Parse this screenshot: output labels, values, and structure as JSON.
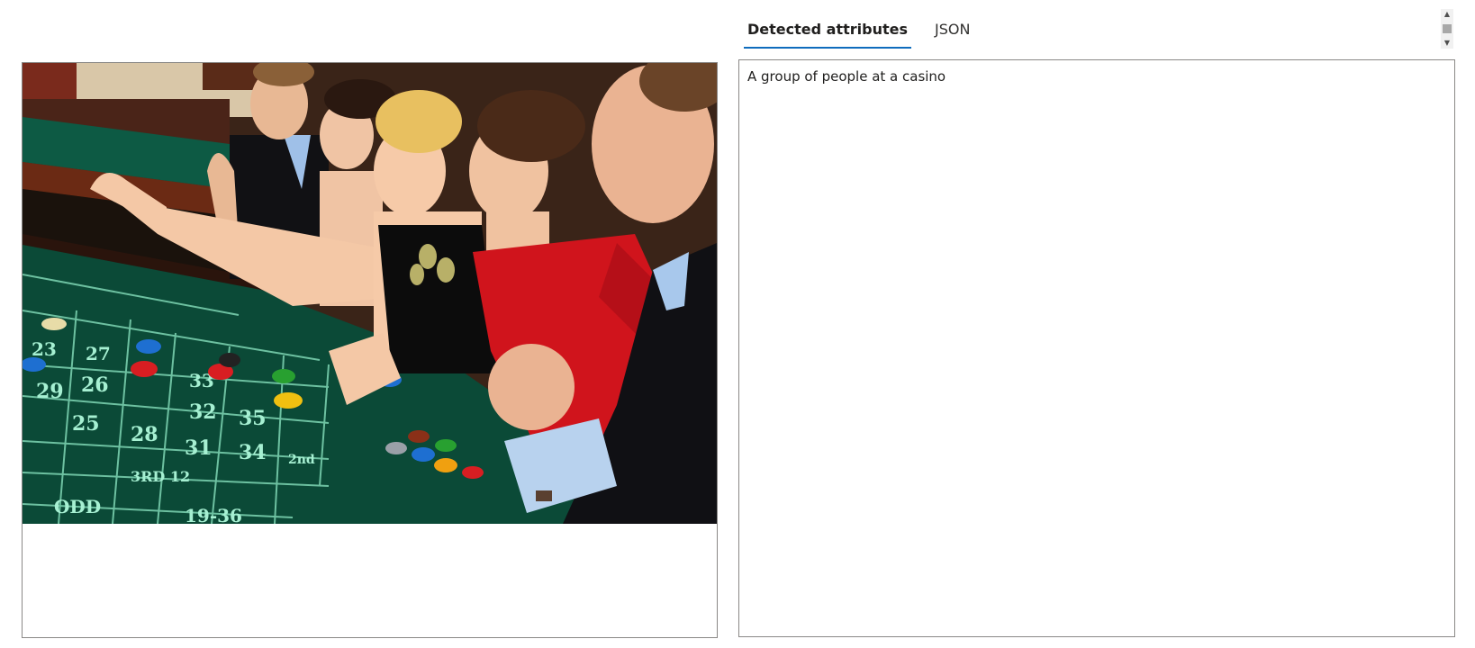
{
  "tabs": [
    {
      "label": "Detected attributes",
      "active": true
    },
    {
      "label": "JSON",
      "active": false
    }
  ],
  "results": {
    "caption": "A group of people at a casino"
  },
  "image": {
    "description_icon": "casino-roulette-photo",
    "table_labels": {
      "third_dozen": "3RD 12",
      "second_dozen": "2nd",
      "odd": "ODD",
      "range": "19-36",
      "numbers": [
        "23",
        "26",
        "29",
        "27",
        "25",
        "28",
        "31",
        "32",
        "33",
        "34",
        "35"
      ]
    }
  },
  "colors": {
    "accent": "#0f6cbd",
    "felt": "#0b4a37",
    "border": "#8a8886"
  }
}
